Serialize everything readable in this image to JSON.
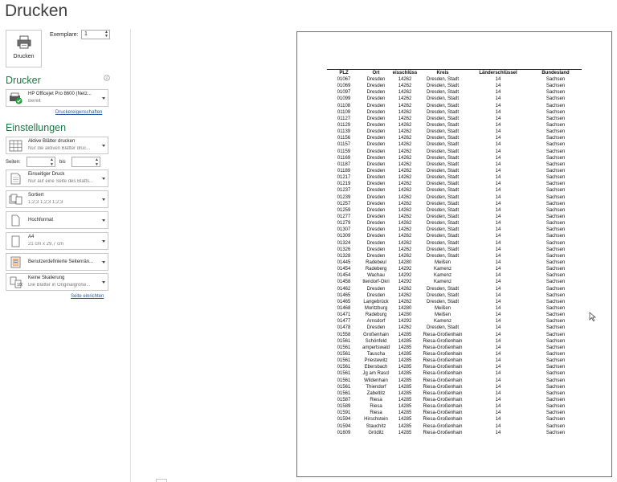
{
  "title": "Drucken",
  "print_button": {
    "label": "Drucken"
  },
  "copies": {
    "label": "Exemplare:",
    "value": "1"
  },
  "printer": {
    "section_title": "Drucker",
    "name": "HP Officejet Pro 8600 (Netz...",
    "status": "Bereit",
    "properties_link": "Druckereigenschaften"
  },
  "settings": {
    "section_title": "Einstellungen",
    "print_what": {
      "title": "Aktive Blätter drucken",
      "desc": "Nur die aktiven Blätter druc..."
    },
    "pages": {
      "label": "Seiten:",
      "to": "bis"
    },
    "sides": {
      "title": "Einseitiger Druck",
      "desc": "Nur auf eine Seite des Blatts..."
    },
    "collation": {
      "title": "Sortiert",
      "desc": "1;2;3    1;2;3    1;2;3"
    },
    "orientation": {
      "title": "Hochformat"
    },
    "paper": {
      "title": "A4",
      "desc": "21 cm x 29,7 cm"
    },
    "margins": {
      "title": "Benutzerdefinierte Seitenrän..."
    },
    "scaling": {
      "title": "Keine Skalierung",
      "desc": "Die Blätter in Originalgröße..."
    },
    "page_setup_link": "Seite einrichten"
  },
  "preview": {
    "headers": [
      "PLZ",
      "Ort",
      "eisschlüss",
      "Kreis",
      "Länderschlüssel",
      "Bundesland"
    ],
    "rows": [
      [
        "01067",
        "Dresden",
        "14262",
        "Dresden, Stadt",
        "14",
        "Sachsen"
      ],
      [
        "01069",
        "Dresden",
        "14262",
        "Dresden, Stadt",
        "14",
        "Sachsen"
      ],
      [
        "01097",
        "Dresden",
        "14262",
        "Dresden, Stadt",
        "14",
        "Sachsen"
      ],
      [
        "01099",
        "Dresden",
        "14262",
        "Dresden, Stadt",
        "14",
        "Sachsen"
      ],
      [
        "01108",
        "Dresden",
        "14262",
        "Dresden, Stadt",
        "14",
        "Sachsen"
      ],
      [
        "01109",
        "Dresden",
        "14262",
        "Dresden, Stadt",
        "14",
        "Sachsen"
      ],
      [
        "01127",
        "Dresden",
        "14262",
        "Dresden, Stadt",
        "14",
        "Sachsen"
      ],
      [
        "01129",
        "Dresden",
        "14262",
        "Dresden, Stadt",
        "14",
        "Sachsen"
      ],
      [
        "01139",
        "Dresden",
        "14262",
        "Dresden, Stadt",
        "14",
        "Sachsen"
      ],
      [
        "01156",
        "Dresden",
        "14262",
        "Dresden, Stadt",
        "14",
        "Sachsen"
      ],
      [
        "01157",
        "Dresden",
        "14262",
        "Dresden, Stadt",
        "14",
        "Sachsen"
      ],
      [
        "01159",
        "Dresden",
        "14262",
        "Dresden, Stadt",
        "14",
        "Sachsen"
      ],
      [
        "01169",
        "Dresden",
        "14262",
        "Dresden, Stadt",
        "14",
        "Sachsen"
      ],
      [
        "01187",
        "Dresden",
        "14262",
        "Dresden, Stadt",
        "14",
        "Sachsen"
      ],
      [
        "01189",
        "Dresden",
        "14262",
        "Dresden, Stadt",
        "14",
        "Sachsen"
      ],
      [
        "01217",
        "Dresden",
        "14262",
        "Dresden, Stadt",
        "14",
        "Sachsen"
      ],
      [
        "01219",
        "Dresden",
        "14262",
        "Dresden, Stadt",
        "14",
        "Sachsen"
      ],
      [
        "01237",
        "Dresden",
        "14262",
        "Dresden, Stadt",
        "14",
        "Sachsen"
      ],
      [
        "01239",
        "Dresden",
        "14262",
        "Dresden, Stadt",
        "14",
        "Sachsen"
      ],
      [
        "01257",
        "Dresden",
        "14262",
        "Dresden, Stadt",
        "14",
        "Sachsen"
      ],
      [
        "01259",
        "Dresden",
        "14262",
        "Dresden, Stadt",
        "14",
        "Sachsen"
      ],
      [
        "01277",
        "Dresden",
        "14262",
        "Dresden, Stadt",
        "14",
        "Sachsen"
      ],
      [
        "01279",
        "Dresden",
        "14262",
        "Dresden, Stadt",
        "14",
        "Sachsen"
      ],
      [
        "01307",
        "Dresden",
        "14262",
        "Dresden, Stadt",
        "14",
        "Sachsen"
      ],
      [
        "01309",
        "Dresden",
        "14262",
        "Dresden, Stadt",
        "14",
        "Sachsen"
      ],
      [
        "01324",
        "Dresden",
        "14262",
        "Dresden, Stadt",
        "14",
        "Sachsen"
      ],
      [
        "01326",
        "Dresden",
        "14262",
        "Dresden, Stadt",
        "14",
        "Sachsen"
      ],
      [
        "01328",
        "Dresden",
        "14262",
        "Dresden, Stadt",
        "14",
        "Sachsen"
      ],
      [
        "01445",
        "Radebeul",
        "14280",
        "Meißen",
        "14",
        "Sachsen"
      ],
      [
        "01454",
        "Radeberg",
        "14292",
        "Kamenz",
        "14",
        "Sachsen"
      ],
      [
        "01454",
        "Wachau",
        "14292",
        "Kamenz",
        "14",
        "Sachsen"
      ],
      [
        "01458",
        "ttendorf-Okri",
        "14292",
        "Kamenz",
        "14",
        "Sachsen"
      ],
      [
        "01462",
        "Dresden",
        "14262",
        "Dresden, Stadt",
        "14",
        "Sachsen"
      ],
      [
        "01465",
        "Dresden",
        "14262",
        "Dresden, Stadt",
        "14",
        "Sachsen"
      ],
      [
        "01465",
        "Langebrück",
        "14262",
        "Dresden, Stadt",
        "14",
        "Sachsen"
      ],
      [
        "01468",
        "Moritzburg",
        "14280",
        "Meißen",
        "14",
        "Sachsen"
      ],
      [
        "01471",
        "Radeburg",
        "14280",
        "Meißen",
        "14",
        "Sachsen"
      ],
      [
        "01477",
        "Arnsdorf",
        "14292",
        "Kamenz",
        "14",
        "Sachsen"
      ],
      [
        "01478",
        "Dresden",
        "14262",
        "Dresden, Stadt",
        "14",
        "Sachsen"
      ],
      [
        "01558",
        "Großenhain",
        "14285",
        "Riesa-Großenhain",
        "14",
        "Sachsen"
      ],
      [
        "01561",
        "Schönfeld",
        "14285",
        "Riesa-Großenhain",
        "14",
        "Sachsen"
      ],
      [
        "01561",
        "ampertswald",
        "14285",
        "Riesa-Großenhain",
        "14",
        "Sachsen"
      ],
      [
        "01561",
        "Tauscha",
        "14285",
        "Riesa-Großenhain",
        "14",
        "Sachsen"
      ],
      [
        "01561",
        "Priestewitz",
        "14285",
        "Riesa-Großenhain",
        "14",
        "Sachsen"
      ],
      [
        "01561",
        "Ebersbach",
        "14285",
        "Riesa-Großenhain",
        "14",
        "Sachsen"
      ],
      [
        "01561",
        "Jg am Rascl",
        "14285",
        "Riesa-Großenhain",
        "14",
        "Sachsen"
      ],
      [
        "01561",
        "Wildenhain",
        "14285",
        "Riesa-Großenhain",
        "14",
        "Sachsen"
      ],
      [
        "01561",
        "Thiendorf",
        "14285",
        "Riesa-Großenhain",
        "14",
        "Sachsen"
      ],
      [
        "01561",
        "Zabeltitz",
        "14285",
        "Riesa-Großenhain",
        "14",
        "Sachsen"
      ],
      [
        "01587",
        "Riesa",
        "14285",
        "Riesa-Großenhain",
        "14",
        "Sachsen"
      ],
      [
        "01589",
        "Riesa",
        "14285",
        "Riesa-Großenhain",
        "14",
        "Sachsen"
      ],
      [
        "01591",
        "Riesa",
        "14285",
        "Riesa-Großenhain",
        "14",
        "Sachsen"
      ],
      [
        "01594",
        "Hirschstein",
        "14285",
        "Riesa-Großenhain",
        "14",
        "Sachsen"
      ],
      [
        "01594",
        "Stauchitz",
        "14285",
        "Riesa-Großenhain",
        "14",
        "Sachsen"
      ],
      [
        "01609",
        "Gröditz",
        "14285",
        "Riesa-Großenhain",
        "14",
        "Sachsen"
      ]
    ]
  }
}
